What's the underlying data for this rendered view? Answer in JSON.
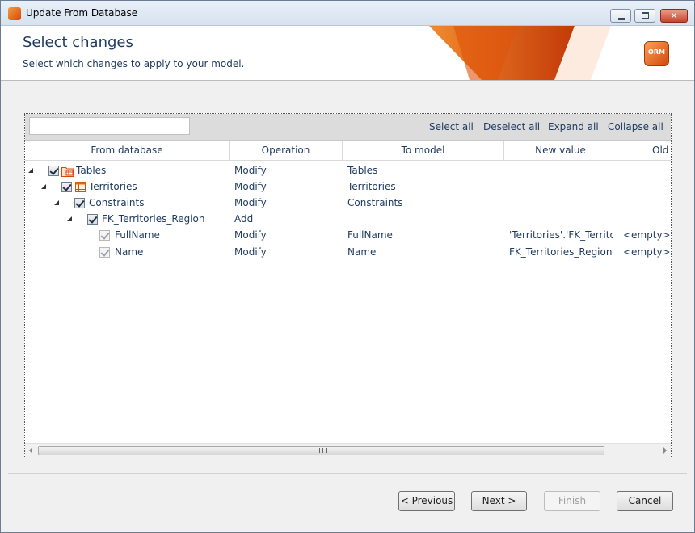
{
  "window": {
    "title": "Update From Database"
  },
  "header": {
    "title": "Select changes",
    "subtitle": "Select which changes to apply to your model.",
    "logo_text": "ORM"
  },
  "toolbar": {
    "search_value": "",
    "select_all": "Select all",
    "deselect_all": "Deselect all",
    "expand_all": "Expand all",
    "collapse_all": "Collapse all"
  },
  "columns": [
    "From database",
    "Operation",
    "To model",
    "New value",
    "Old v"
  ],
  "rows": [
    {
      "name": "Tables",
      "operation": "Modify",
      "to_model": "Tables",
      "new_value": "",
      "old_value": "",
      "checked": true,
      "icon": "tables-folder-icon"
    },
    {
      "name": "Territories",
      "operation": "Modify",
      "to_model": "Territories",
      "new_value": "",
      "old_value": "",
      "checked": true,
      "icon": "table-icon"
    },
    {
      "name": "Constraints",
      "operation": "Modify",
      "to_model": "Constraints",
      "new_value": "",
      "old_value": "",
      "checked": true,
      "icon": ""
    },
    {
      "name": "FK_Territories_Region",
      "operation": "Add",
      "to_model": "",
      "new_value": "",
      "old_value": "",
      "checked": true,
      "icon": ""
    },
    {
      "name": "FullName",
      "operation": "Modify",
      "to_model": "FullName",
      "new_value": "'Territories'.'FK_Territorie",
      "old_value": "<empty>",
      "checked": true,
      "icon": ""
    },
    {
      "name": "Name",
      "operation": "Modify",
      "to_model": "Name",
      "new_value": "FK_Territories_Region",
      "old_value": "<empty>",
      "checked": true,
      "icon": ""
    }
  ],
  "buttons": {
    "previous": "< Previous",
    "next": "Next >",
    "finish": "Finish",
    "cancel": "Cancel"
  },
  "colors": {
    "accent": "#e8650a",
    "text": "#1e3a5f"
  }
}
